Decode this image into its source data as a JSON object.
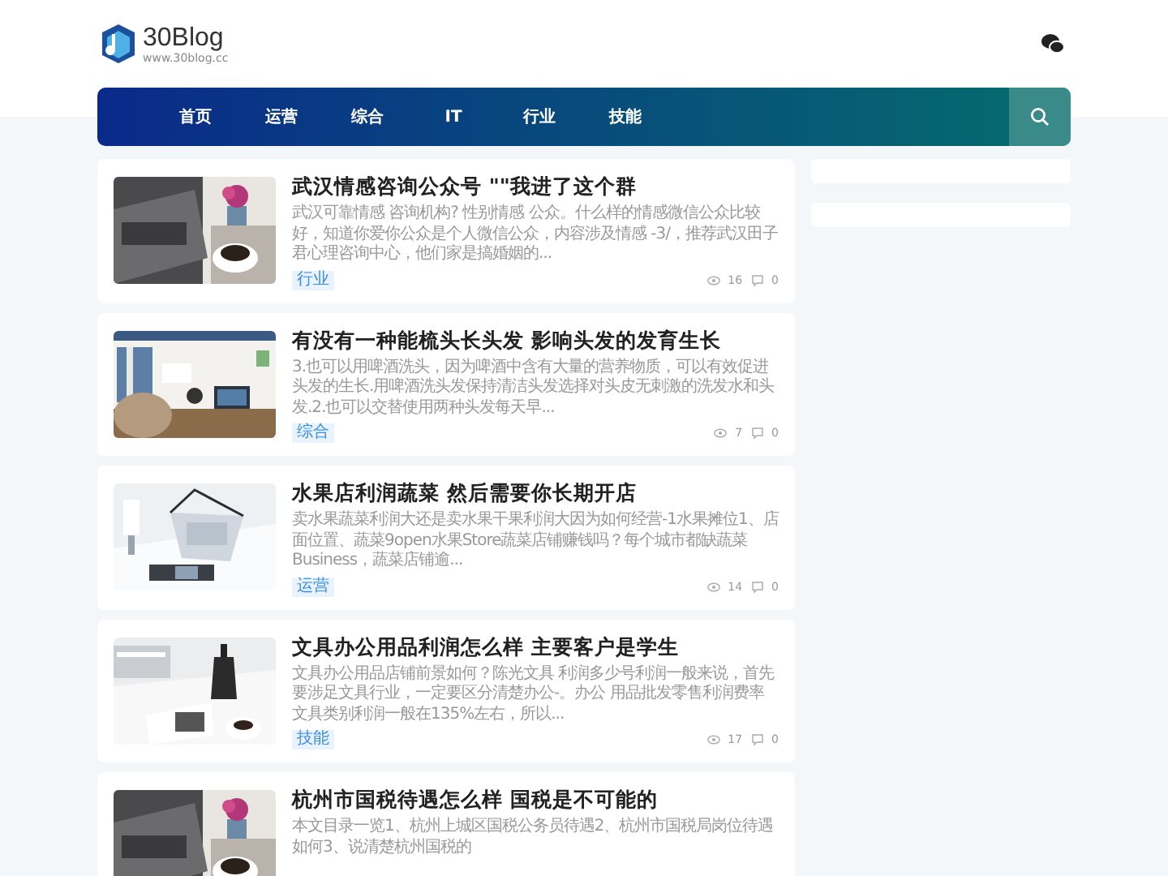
{
  "site": {
    "name": "30Blog",
    "url": "www.30blog.cc"
  },
  "nav": {
    "items": [
      {
        "label": "首页"
      },
      {
        "label": "运营"
      },
      {
        "label": "综合"
      },
      {
        "label": "IT"
      },
      {
        "label": "行业"
      },
      {
        "label": "技能"
      }
    ]
  },
  "posts": [
    {
      "title": "武汉情感咨询公众号 \"\"我进了这个群",
      "excerpt": "武汉可靠情感 咨询机构? 性别情感 公众。什么样的情感微信公众比较好，知道你爱你公众是个人微信公众，内容涉及情感 -3/，推荐武汉田子君心理咨询中心，他们家是搞婚姻的...",
      "tag": "行业",
      "views": "16",
      "comments": "0"
    },
    {
      "title": "有没有一种能梳头长头发 影响头发的发育生长",
      "excerpt": "3.也可以用啤酒洗头，因为啤酒中含有大量的营养物质，可以有效促进头发的生长.用啤酒洗头发保持清洁头发选择对头皮无刺激的洗发水和头发.2.也可以交替使用两种头发每天早...",
      "tag": "综合",
      "views": "7",
      "comments": "0"
    },
    {
      "title": "水果店利润蔬菜 然后需要你长期开店",
      "excerpt": "卖水果蔬菜利润大还是卖水果干果利润大因为如何经营-1水果摊位1、店面位置、蔬菜9open水果Store蔬菜店铺赚钱吗？每个城市都缺蔬菜 Business，蔬菜店铺逾...",
      "tag": "运营",
      "views": "14",
      "comments": "0"
    },
    {
      "title": "文具办公用品利润怎么样 主要客户是学生",
      "excerpt": "文具办公用品店铺前景如何？陈光文具 利润多少号利润一般来说，首先要涉足文具行业，一定要区分清楚办公-。办公 用品批发零售利润费率文具类别利润一般在135%左右，所以...",
      "tag": "技能",
      "views": "17",
      "comments": "0"
    },
    {
      "title": "杭州市国税待遇怎么样 国税是不可能的",
      "excerpt": "本文目录一览1、杭州上城区国税公务员待遇2、杭州市国税局岗位待遇如何3、说清楚杭州国税的"
    }
  ],
  "sidebar": {
    "panels": [
      {
        "kind": "empty"
      },
      {
        "kind": "empty"
      }
    ]
  }
}
